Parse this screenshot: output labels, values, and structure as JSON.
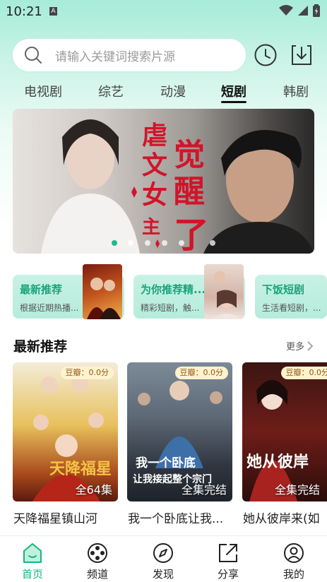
{
  "status_bar": {
    "time": "10:21",
    "indicator": "A"
  },
  "search": {
    "placeholder": "请输入关键词搜索片源"
  },
  "header_icons": [
    "history-clock-icon",
    "download-icon"
  ],
  "tabs": [
    {
      "label": "电视剧"
    },
    {
      "label": "综艺"
    },
    {
      "label": "动漫"
    },
    {
      "label": "短剧",
      "active": true
    },
    {
      "label": "韩剧"
    }
  ],
  "banner": {
    "text": "虐文女主觉醒了",
    "active_dot": 0,
    "dot_count": 6
  },
  "categories": [
    {
      "title": "最新推荐",
      "subtitle": "根据近期热播..."
    },
    {
      "title": "为你推荐精...",
      "subtitle": "精彩短剧，触..."
    },
    {
      "title": "下饭短剧",
      "subtitle": "生活看短剧，..."
    }
  ],
  "section": {
    "title": "最新推荐",
    "more": "更多"
  },
  "posters": [
    {
      "score": "豆瓣：0.0分",
      "status": "全64集",
      "title": "天降福星镇山河"
    },
    {
      "score": "豆瓣：0.0分",
      "status": "全集完结",
      "title": "我一个卧底让我..."
    },
    {
      "score": "豆瓣：0.0分",
      "status": "全集完结",
      "title": "她从彼岸来(如"
    }
  ],
  "bottom_nav": [
    {
      "label": "首页",
      "icon": "home-icon",
      "active": true
    },
    {
      "label": "频道",
      "icon": "film-reel-icon"
    },
    {
      "label": "发现",
      "icon": "compass-icon"
    },
    {
      "label": "分享",
      "icon": "share-icon"
    },
    {
      "label": "我的",
      "icon": "profile-icon"
    }
  ],
  "colors": {
    "accent": "#19b482",
    "card_bg": "#c8f1e4",
    "score_bg": "#fff2cf"
  }
}
